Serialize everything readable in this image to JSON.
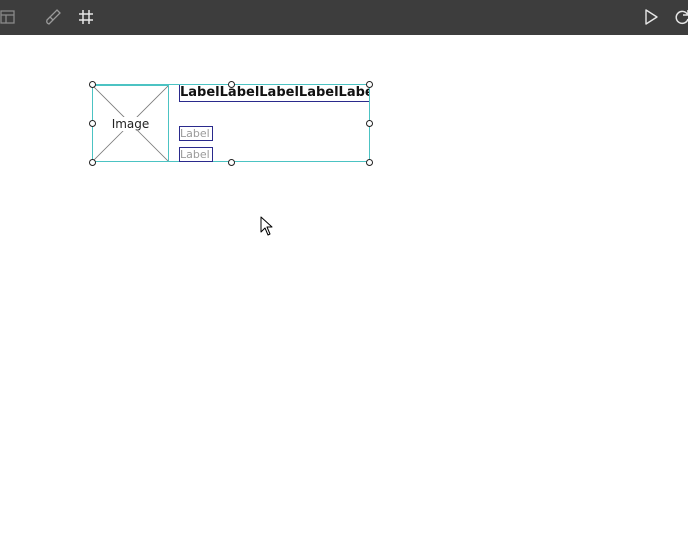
{
  "toolbar": {
    "background": "#3d3d3d",
    "left_icons": [
      "layout-icon",
      "brush-icon",
      "grid-icon"
    ],
    "right_icons": [
      "play-icon",
      "refresh-icon"
    ]
  },
  "canvas": {
    "selection_color": "#4cc3c3",
    "label_border_color": "#2a2a8c",
    "image_placeholder": {
      "text": "Image"
    },
    "title_label": {
      "text": "LabelLabelLabelLabelLabel"
    },
    "label_1": {
      "text": "Label"
    },
    "label_2": {
      "text": "Label"
    }
  }
}
